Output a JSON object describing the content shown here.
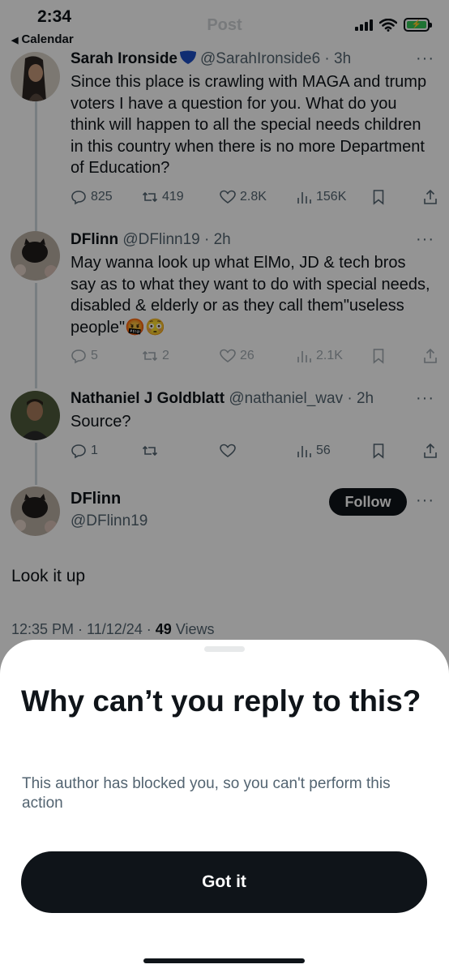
{
  "status_bar": {
    "time": "2:34",
    "back_app": "Calendar",
    "nav_title": "Post",
    "battery_icon": "battery-charging-icon"
  },
  "thread": [
    {
      "name": "Sarah Ironside",
      "handle": "@SarahIronside6",
      "time": "3h",
      "verified": true,
      "text": "Since this place is crawling with MAGA and trump voters I have a question for you. What do you think will happen to all the special needs children in this country when there is no more Department of Education?",
      "replies": "825",
      "reposts": "419",
      "likes": "2.8K",
      "views": "156K"
    },
    {
      "name": "DFlinn",
      "handle": "@DFlinn19",
      "time": "2h",
      "text": "May wanna look up what ElMo, JD & tech bros say as to what they want to do with special needs, disabled & elderly or as they call them\"useless people\"",
      "emojis": "🤬😳",
      "replies": "5",
      "reposts": "2",
      "likes": "26",
      "views": "2.1K"
    },
    {
      "name": "Nathaniel J Goldblatt",
      "handle": "@nathaniel_wav",
      "time": "2h",
      "text": "Source?",
      "replies": "1",
      "reposts": "",
      "likes": "",
      "views": "56"
    }
  ],
  "main_tweet": {
    "name": "DFlinn",
    "handle": "@DFlinn19",
    "follow_label": "Follow",
    "text": "Look it up",
    "timestamp": "12:35 PM · 11/12/24 ·",
    "views_count": "49",
    "views_label": "Views"
  },
  "sheet": {
    "title": "Why can’t you reply to this?",
    "body": "This author has blocked you, so you can't perform this action",
    "button_label": "Got it"
  },
  "colors": {
    "accent_dark": "#0f1419",
    "secondary_text": "#536471",
    "verified_blue": "#1d4fc4",
    "overlay": "rgba(0,0,0,0.42)"
  }
}
